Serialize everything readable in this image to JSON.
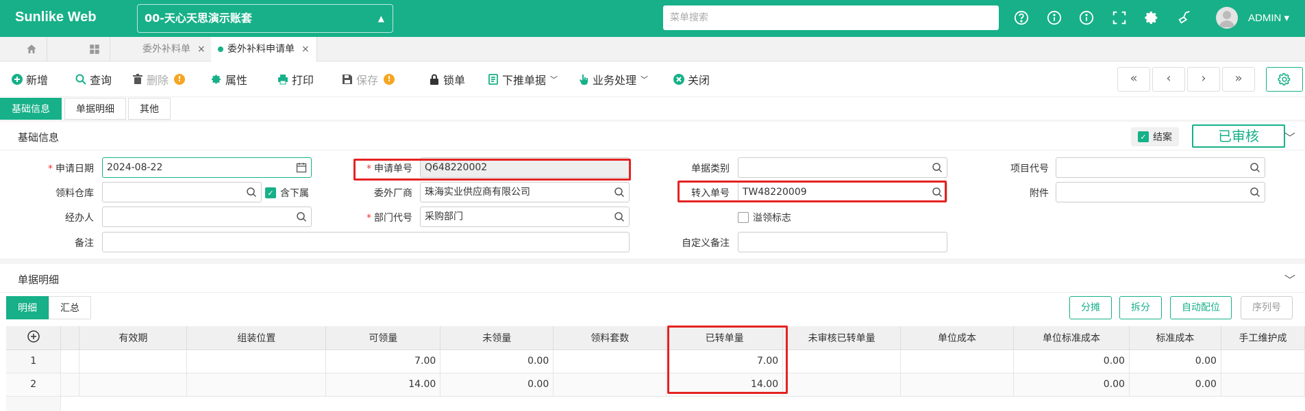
{
  "header": {
    "brand": "Sunlike Web",
    "account": "00-天心天思演示账套",
    "search_placeholder": "菜单搜索",
    "user": "ADMIN ▾"
  },
  "tabs": {
    "items": [
      {
        "label": "委外补料单",
        "close": "×"
      },
      {
        "label": "委外补料申请单",
        "close": "×"
      }
    ]
  },
  "toolbar": {
    "add": "新增",
    "query": "查询",
    "delete": "删除",
    "properties": "属性",
    "print": "打印",
    "save": "保存",
    "lock": "锁单",
    "push_down": "下推单据",
    "business": "业务处理",
    "close": "关闭",
    "warn": "!"
  },
  "subtabs": [
    "基础信息",
    "单据明细",
    "其他"
  ],
  "basic_section": {
    "title": "基础信息",
    "closed_label": "结案",
    "approved": "已审核"
  },
  "form": {
    "apply_date_label": "申请日期",
    "apply_date": "2024-08-22",
    "apply_no_label": "申请单号",
    "apply_no": "Q648220002",
    "doc_type_label": "单据类别",
    "doc_type": "",
    "project_label": "项目代号",
    "project": "",
    "warehouse_label": "领料仓库",
    "warehouse": "",
    "sub_label": "含下属",
    "vendor_label": "委外厂商",
    "vendor": "珠海实业供应商有限公司",
    "transfer_label": "转入单号",
    "transfer": "TW48220009",
    "attach_label": "附件",
    "attach": "",
    "handler_label": "经办人",
    "handler": "",
    "dept_label": "部门代号",
    "dept": "采购部门",
    "overflow_label": "溢领标志",
    "remark_label": "备注",
    "remark": "",
    "custom_remark_label": "自定义备注",
    "custom_remark": ""
  },
  "detail_section": {
    "title": "单据明细",
    "tab_detail": "明细",
    "tab_summary": "汇总",
    "btn_split_alloc": "分摊",
    "btn_split": "拆分",
    "btn_auto": "自动配位",
    "btn_serial": "序列号"
  },
  "grid": {
    "columns": [
      "有效期",
      "组装位置",
      "可领量",
      "未领量",
      "领料套数",
      "已转单量",
      "未审核已转单量",
      "单位成本",
      "单位标准成本",
      "标准成本",
      "手工维护成"
    ],
    "rows": [
      {
        "no": "1",
        "cells": [
          "",
          "",
          "7.00",
          "0.00",
          "",
          "7.00",
          "",
          "",
          "0.00",
          "0.00",
          ""
        ]
      },
      {
        "no": "2",
        "cells": [
          "",
          "",
          "14.00",
          "0.00",
          "",
          "14.00",
          "",
          "",
          "0.00",
          "0.00",
          ""
        ]
      }
    ]
  },
  "colors": {
    "brand": "#17b088",
    "highlight": "#e52222"
  }
}
